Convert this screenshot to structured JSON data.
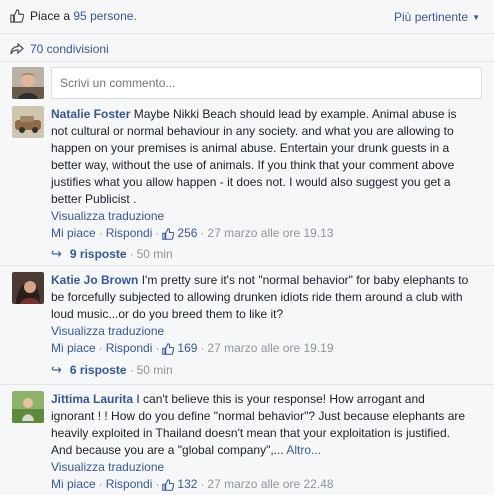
{
  "likes": {
    "prefix": "Piace a",
    "count": "95",
    "suffix": "persone.",
    "sort_label": "Più pertinente"
  },
  "shares": {
    "label": "70 condivisioni"
  },
  "composer": {
    "placeholder": "Scrivi un commento..."
  },
  "comments": [
    {
      "author": "Natalie Foster",
      "text": "Maybe Nikki Beach should lead by example. Animal abuse is not cultural or normal behaviour in any society. and what you are allowing to happen on your premises is animal abuse. Entertain your drunk guests in a better way, without the use of animals. If you think that your comment above justifies what you allow happen - it does not. I would also suggest you get a better Publicist .",
      "translate": "Visualizza traduzione",
      "like": "Mi piace",
      "reply": "Rispondi",
      "reactions": "256",
      "date": "27 marzo alle ore 19.13",
      "replies": "9 risposte",
      "replies_time": "50 min"
    },
    {
      "author": "Katie Jo Brown",
      "text": "I'm pretty sure it's not \"normal behavior\" for baby elephants to be forcefully subjected to allowing drunken idiots ride them around a club with loud music...or do you breed them to like it?",
      "translate": "Visualizza traduzione",
      "like": "Mi piace",
      "reply": "Rispondi",
      "reactions": "169",
      "date": "27 marzo alle ore 19.19",
      "replies": "6 risposte",
      "replies_time": "50 min"
    },
    {
      "author": "Jittima Laurita",
      "text": "I can't believe this is your response! How arrogant and ignorant ! ! How do you define \"normal behavior\"? Just because elephants are heavily exploited in Thailand doesn't mean that your exploitation is justified. And because you are a \"global company\",...",
      "more": "Altro...",
      "translate": "Visualizza traduzione",
      "like": "Mi piace",
      "reply": "Rispondi",
      "reactions": "132",
      "date": "27 marzo alle ore 22.48"
    }
  ]
}
